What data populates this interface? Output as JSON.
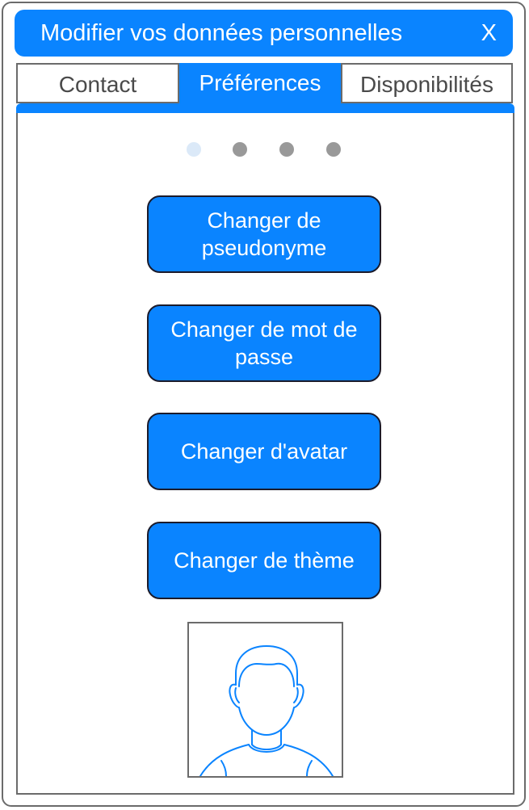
{
  "dialog": {
    "title": "Modifier vos données personnelles",
    "close_label": "X"
  },
  "tabs": [
    {
      "label": "Contact",
      "active": false
    },
    {
      "label": "Préférences",
      "active": true
    },
    {
      "label": "Disponibilités",
      "active": false
    }
  ],
  "pager": {
    "count": 4,
    "active_index": 0
  },
  "buttons": {
    "pseudonyme": "Changer de pseudonyme",
    "password": "Changer de mot de passe",
    "avatar": "Changer d'avatar",
    "theme": "Changer de thème"
  },
  "avatar": {
    "icon": "person-avatar-icon"
  },
  "colors": {
    "accent": "#0a84ff",
    "border": "#6b6b6b",
    "dot_active": "#dbe9f8",
    "dot_inactive": "#999999"
  }
}
